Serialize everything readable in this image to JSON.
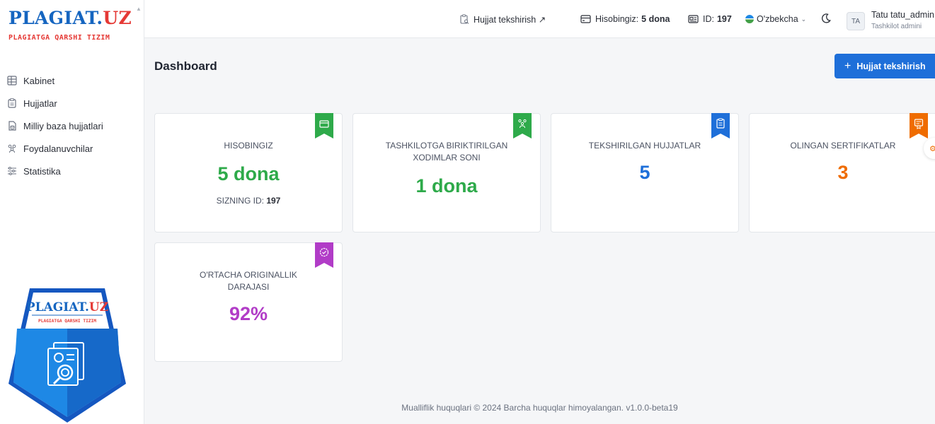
{
  "brand": {
    "logo_part1": "PLAGIAT.",
    "logo_part2": "UZ",
    "subtitle": "PLAGIATGA QARSHI TIZIM",
    "colors": {
      "blue": "#1565c0",
      "red": "#e53935"
    }
  },
  "sidebar": {
    "items": [
      {
        "label": "Kabinet",
        "icon": "grid-icon"
      },
      {
        "label": "Hujjatlar",
        "icon": "clipboard-icon"
      },
      {
        "label": "Milliy baza hujjatlari",
        "icon": "database-doc-icon"
      },
      {
        "label": "Foydalanuvchilar",
        "icon": "users-icon"
      },
      {
        "label": "Statistika",
        "icon": "sliders-icon"
      }
    ]
  },
  "header": {
    "check_link": "Hujjat tekshirish ↗",
    "balance_label": "Hisobingiz:",
    "balance_value": "5 dona",
    "id_label": "ID:",
    "id_value": "197",
    "language": "O'zbekcha",
    "avatar_initials": "TA",
    "user_name": "Tatu tatu_admin",
    "user_role": "Tashkilot admini"
  },
  "main": {
    "title": "Dashboard",
    "primary_button": "Hujjat tekshirish",
    "cards": [
      {
        "label": "HISOBINGIZ",
        "value": "5 dona",
        "sub_label": "SIZNING ID:",
        "sub_value": "197",
        "color": "#2eaa4a",
        "icon": "wallet-icon"
      },
      {
        "label": "TASHKILOTGA BIRIKTIRILGAN XODIMLAR SONI",
        "value": "1 dona",
        "color": "#2eaa4a",
        "icon": "users-icon"
      },
      {
        "label": "TEKSHIRILGAN HUJJATLAR",
        "value": "5",
        "color": "#1e6fd9",
        "icon": "clipboard-icon"
      },
      {
        "label": "OLINGAN SERTIFIKATLAR",
        "value": "3",
        "color": "#ef6c00",
        "icon": "certificate-icon"
      },
      {
        "label": "O'RTACHA ORIGINALLIK DARAJASI",
        "value": "92%",
        "color": "#b13cc7",
        "icon": "badge-check-icon"
      }
    ]
  },
  "footer": {
    "text": "Mualliflik huquqlari © 2024 Barcha huquqlar himoyalangan. v1.0.0-beta19"
  }
}
